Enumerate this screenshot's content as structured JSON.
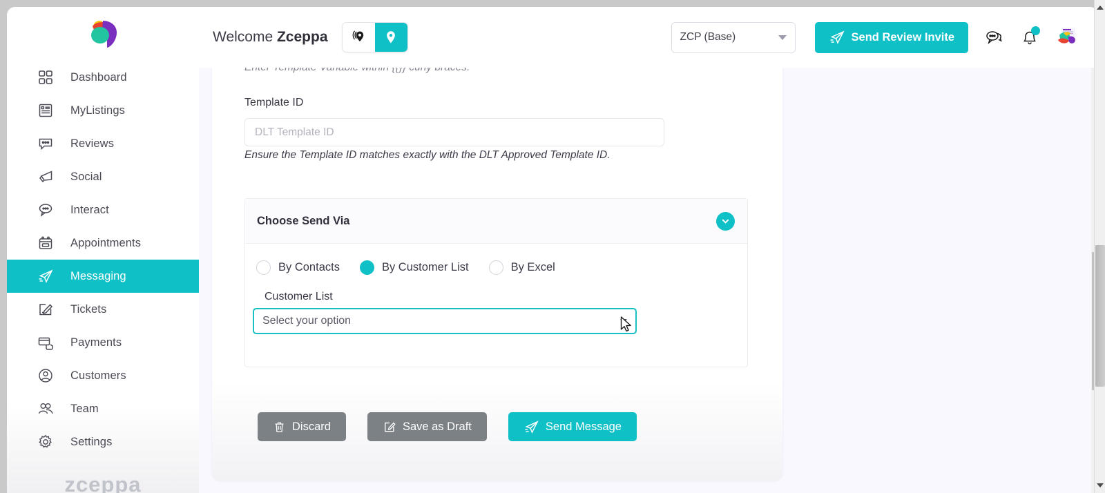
{
  "app": {
    "brand_wordmark": "zceppa",
    "accent_color": "#0fc0c7",
    "grey_button_color": "#7c8186",
    "page_background": "#faf8ff"
  },
  "sidebar": {
    "logo_icon": "zceppa-logo-icon",
    "items": [
      {
        "label": "Dashboard",
        "icon": "grid-icon",
        "active": false
      },
      {
        "label": "MyListings",
        "icon": "list-card-icon",
        "active": false
      },
      {
        "label": "Reviews",
        "icon": "chat-dots-icon",
        "active": false
      },
      {
        "label": "Social",
        "icon": "megaphone-icon",
        "active": false
      },
      {
        "label": "Interact",
        "icon": "speech-bubbles-icon",
        "active": false
      },
      {
        "label": "Appointments",
        "icon": "calendar-icon",
        "active": false
      },
      {
        "label": "Messaging",
        "icon": "paper-plane-icon",
        "active": true
      },
      {
        "label": "Tickets",
        "icon": "pencil-note-icon",
        "active": false
      },
      {
        "label": "Payments",
        "icon": "card-hand-icon",
        "active": false
      },
      {
        "label": "Customers",
        "icon": "user-badge-icon",
        "active": false
      },
      {
        "label": "Team",
        "icon": "users-group-icon",
        "active": false
      },
      {
        "label": "Settings",
        "icon": "gear-icon",
        "active": false
      }
    ]
  },
  "topbar": {
    "welcome_prefix": "Welcome ",
    "welcome_name": "Zceppa",
    "location_toggle": {
      "multi_location_icon": "multi-location-pin-icon",
      "single_location_icon": "location-pin-icon",
      "selected": "single"
    },
    "account_select": {
      "value": "ZCP (Base)",
      "caret_icon": "chevron-down-icon"
    },
    "send_review_invite": {
      "label": "Send Review Invite",
      "icon": "paper-plane-icon"
    },
    "chat_icon": "chat-bubbles-icon",
    "notification_icon": "bell-icon",
    "notification_badge": true,
    "avatar_icon": "user-avatar-icon"
  },
  "main": {
    "cut_off_hint": "Enter Template Variable within {{}} curly braces.",
    "template_id": {
      "label": "Template ID",
      "placeholder": "DLT Template ID",
      "value": "",
      "helper": "Ensure the Template ID matches exactly with the DLT Approved Template ID."
    },
    "send_via_panel": {
      "title": "Choose Send Via",
      "collapse_icon": "chevron-down-icon",
      "options": [
        {
          "label": "By Contacts",
          "selected": false
        },
        {
          "label": "By Customer List",
          "selected": true
        },
        {
          "label": "By Excel",
          "selected": false
        }
      ],
      "customer_list": {
        "label": "Customer List",
        "placeholder": "Select your option",
        "value": "Select your option",
        "caret_icon": "chevron-down-icon"
      }
    },
    "actions": [
      {
        "label": "Discard",
        "icon": "trash-icon",
        "style": "grey"
      },
      {
        "label": "Save as Draft",
        "icon": "save-draft-icon",
        "style": "grey"
      },
      {
        "label": "Send Message",
        "icon": "paper-plane-icon",
        "style": "teal"
      }
    ]
  }
}
